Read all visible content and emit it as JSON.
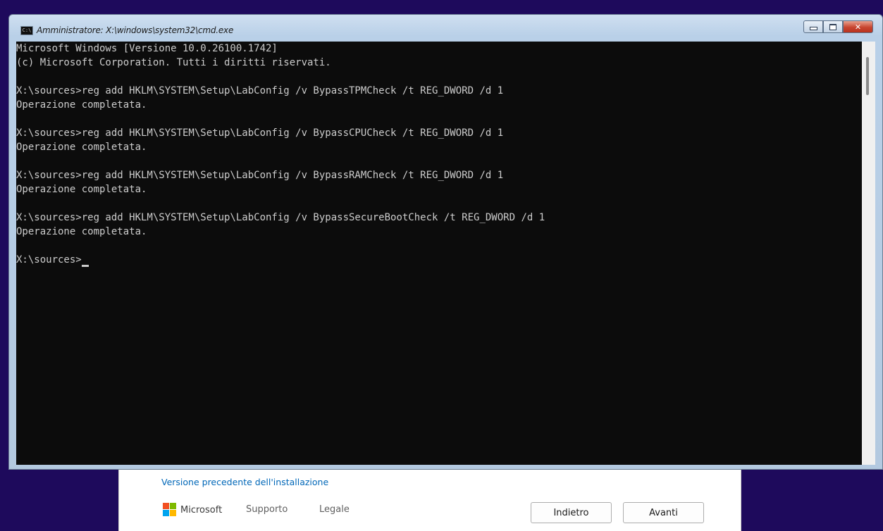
{
  "setup": {
    "previous_install_link": "Versione precedente dell'installazione",
    "brand": "Microsoft",
    "support_link": "Supporto",
    "legal_link": "Legale",
    "back_button": "Indietro",
    "next_button": "Avanti"
  },
  "console_window": {
    "title": "Amministratore: X:\\windows\\system32\\cmd.exe",
    "app_icon_text": "C:\\",
    "lines": [
      "Microsoft Windows [Versione 10.0.26100.1742]",
      "(c) Microsoft Corporation. Tutti i diritti riservati.",
      "",
      "X:\\sources>reg add HKLM\\SYSTEM\\Setup\\LabConfig /v BypassTPMCheck /t REG_DWORD /d 1",
      "Operazione completata.",
      "",
      "X:\\sources>reg add HKLM\\SYSTEM\\Setup\\LabConfig /v BypassCPUCheck /t REG_DWORD /d 1",
      "Operazione completata.",
      "",
      "X:\\sources>reg add HKLM\\SYSTEM\\Setup\\LabConfig /v BypassRAMCheck /t REG_DWORD /d 1",
      "Operazione completata.",
      "",
      "X:\\sources>reg add HKLM\\SYSTEM\\Setup\\LabConfig /v BypassSecureBootCheck /t REG_DWORD /d 1",
      "Operazione completata.",
      ""
    ],
    "prompt": "X:\\sources>"
  },
  "colors": {
    "desktop_background": "#1e0a5c",
    "console_background": "#0c0c0c",
    "console_text": "#cccccc",
    "link": "#0067b8"
  }
}
